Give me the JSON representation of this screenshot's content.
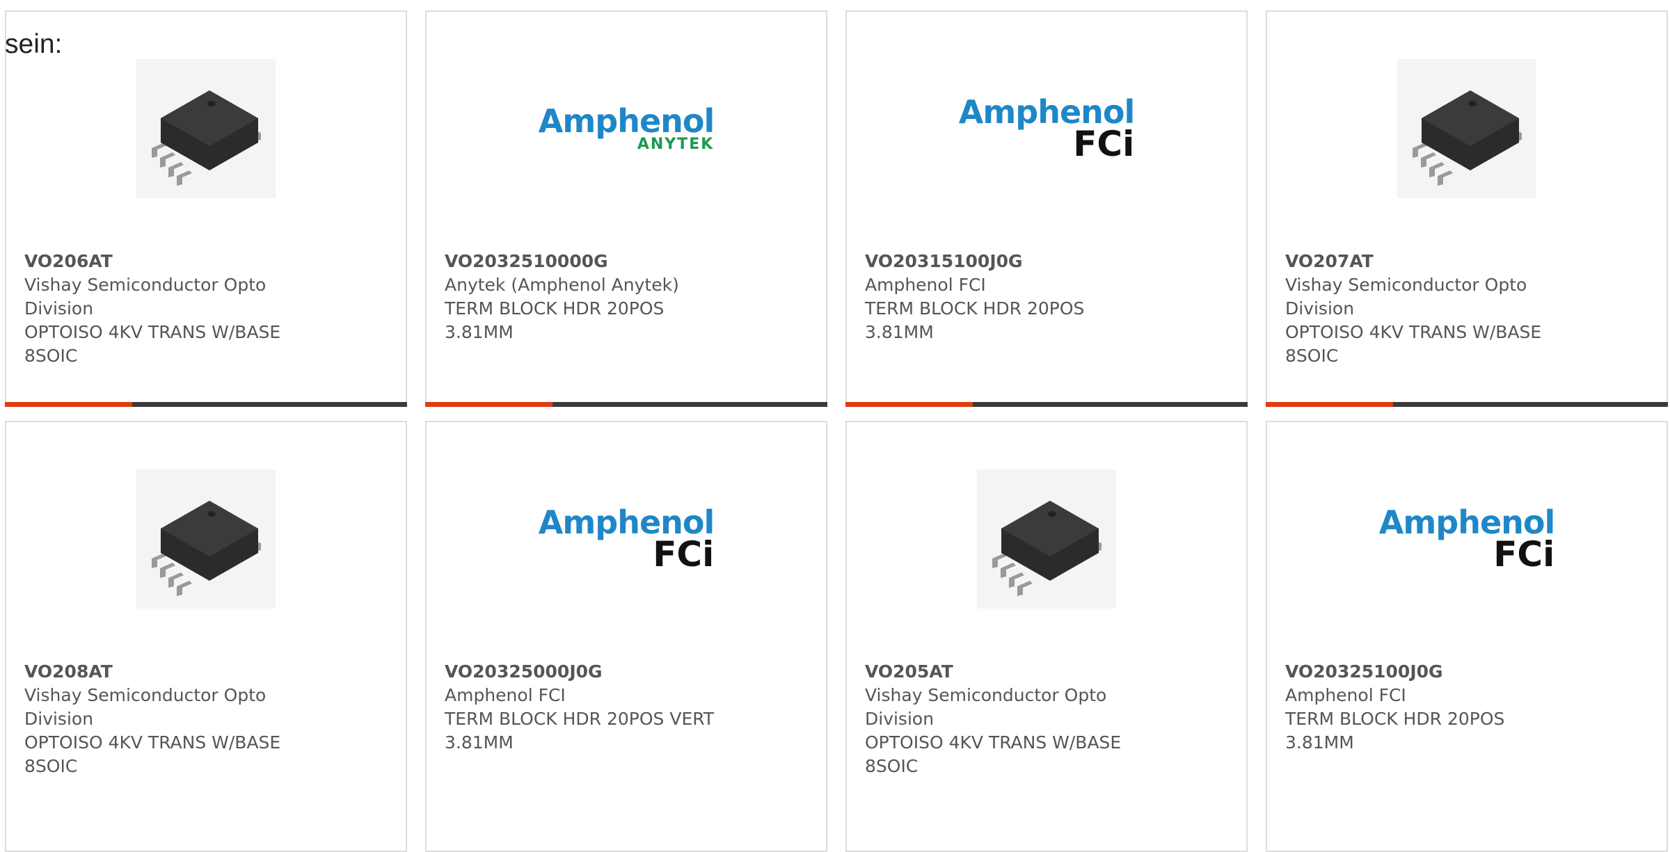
{
  "prefix_text": "sein:",
  "colors": {
    "accent": "#e03c0f",
    "bar": "#3a3a3a",
    "amphenol_blue": "#1f87c8",
    "anytek_green": "#1a9a4d"
  },
  "products": [
    {
      "part_number": "VO206AT",
      "manufacturer": "Vishay Semiconductor Opto Division",
      "description": "OPTOISO 4KV TRANS W/BASE 8SOIC",
      "image": "soic-8-chip-icon"
    },
    {
      "part_number": "VO2032510000G",
      "manufacturer": "Anytek (Amphenol Anytek)",
      "description": "TERM BLOCK HDR 20POS 3.81MM",
      "image": "amphenol-anytek-logo",
      "logo": {
        "brand": "Amphenol",
        "sub": "ANYTEK"
      }
    },
    {
      "part_number": "VO20315100J0G",
      "manufacturer": "Amphenol FCI",
      "description": "TERM BLOCK HDR 20POS 3.81MM",
      "image": "amphenol-fci-logo",
      "logo": {
        "brand": "Amphenol",
        "sub": "FCi"
      }
    },
    {
      "part_number": "VO207AT",
      "manufacturer": "Vishay Semiconductor Opto Division",
      "description": "OPTOISO 4KV TRANS W/BASE 8SOIC",
      "image": "soic-8-chip-icon"
    },
    {
      "part_number": "VO208AT",
      "manufacturer": "Vishay Semiconductor Opto Division",
      "description": "OPTOISO 4KV TRANS W/BASE 8SOIC",
      "image": "soic-8-chip-icon"
    },
    {
      "part_number": "VO20325000J0G",
      "manufacturer": "Amphenol FCI",
      "description": "TERM BLOCK HDR 20POS VERT 3.81MM",
      "image": "amphenol-fci-logo",
      "logo": {
        "brand": "Amphenol",
        "sub": "FCi"
      }
    },
    {
      "part_number": "VO205AT",
      "manufacturer": "Vishay Semiconductor Opto Division",
      "description": "OPTOISO 4KV TRANS W/BASE 8SOIC",
      "image": "soic-8-chip-icon"
    },
    {
      "part_number": "VO20325100J0G",
      "manufacturer": "Amphenol FCI",
      "description": "TERM BLOCK HDR 20POS 3.81MM",
      "image": "amphenol-fci-logo",
      "logo": {
        "brand": "Amphenol",
        "sub": "FCi"
      }
    }
  ]
}
